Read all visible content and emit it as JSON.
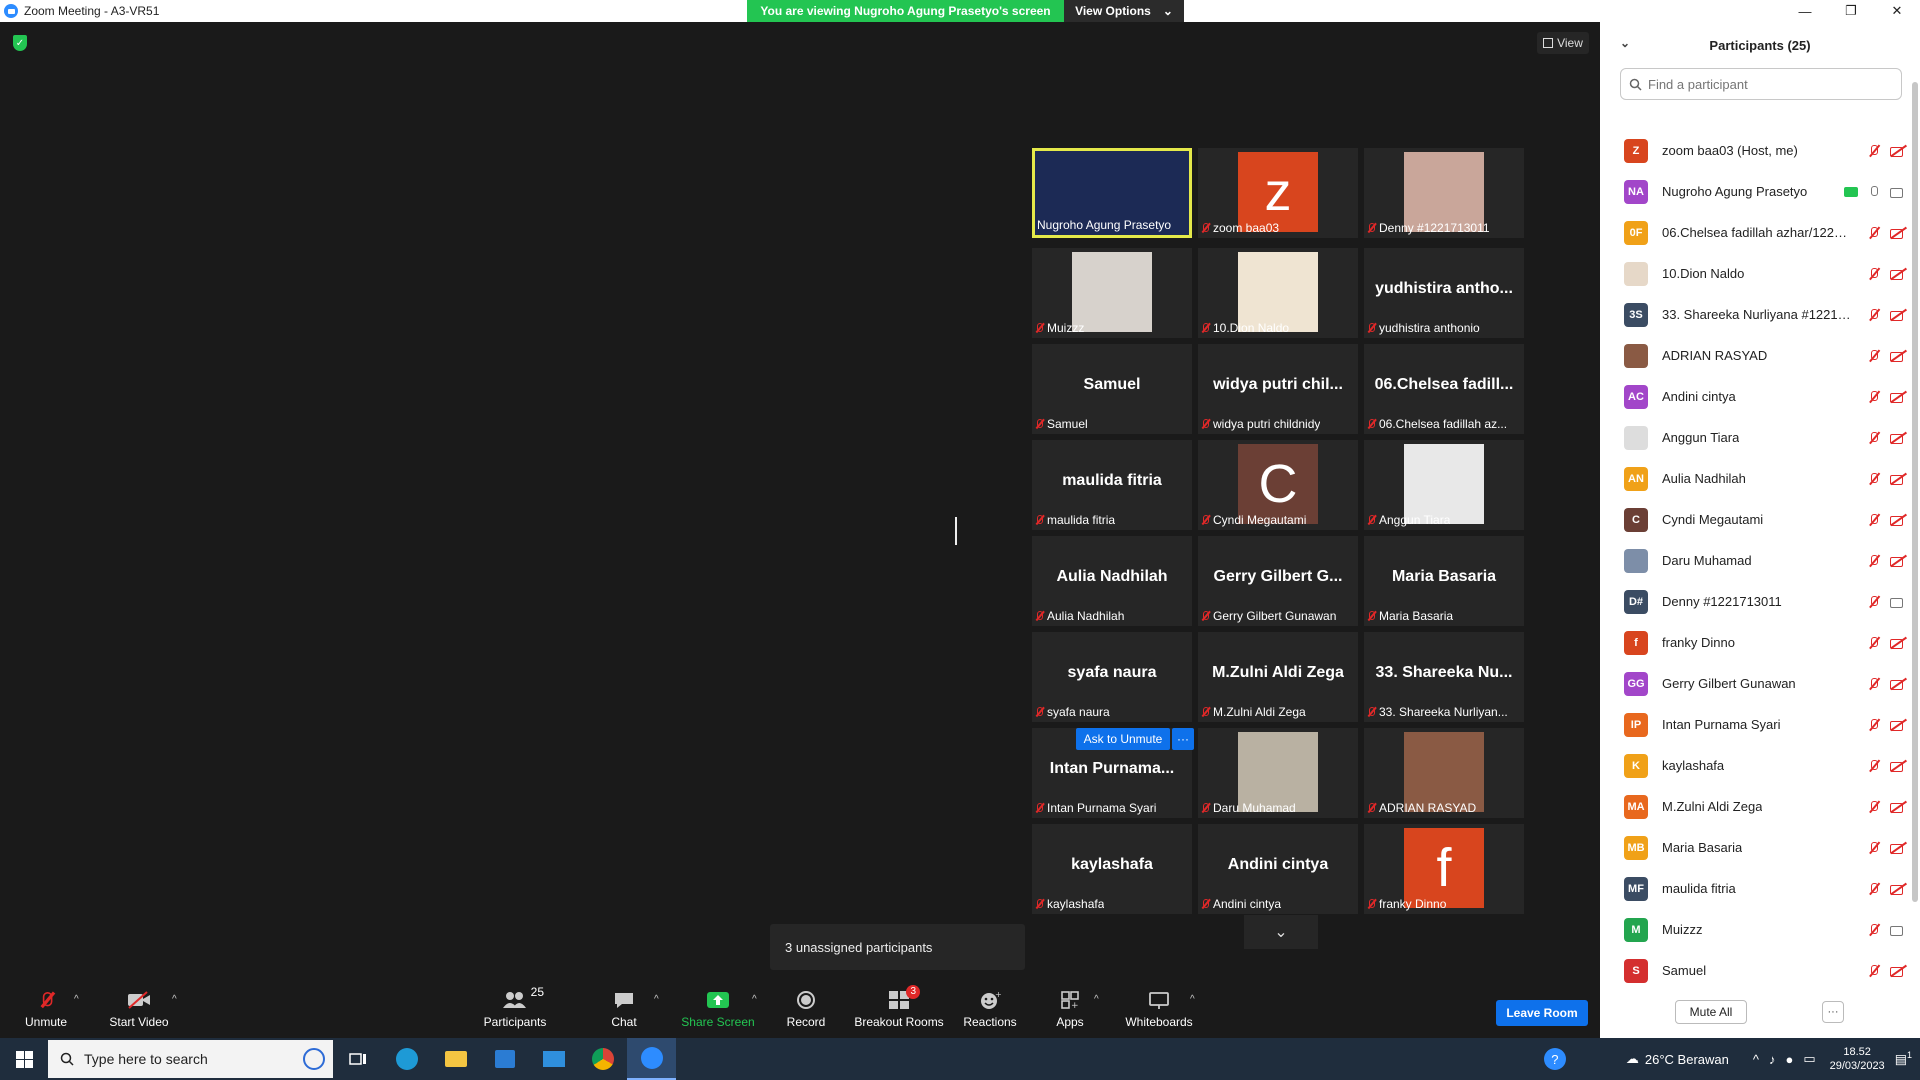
{
  "window": {
    "title": "Zoom Meeting - A3-VR51",
    "banner_text": "You are viewing Nugroho Agung Prasetyo's screen",
    "view_options_label": "View Options",
    "controls": [
      "—",
      "❐",
      "✕"
    ]
  },
  "main": {
    "view_label": "View",
    "ask_to_unmute_label": "Ask to Unmute",
    "ask_more_label": "···",
    "unassigned_text": "3 unassigned participants"
  },
  "gallery": [
    {
      "big": "",
      "tag": "Nugroho Agung Prasetyo",
      "muted": false,
      "kind": "photo",
      "color": "#1c2a55",
      "active": true
    },
    {
      "big": "",
      "tag": "zoom baa03",
      "muted": true,
      "kind": "avatar",
      "letter": "z",
      "color": "#d8451e"
    },
    {
      "big": "",
      "tag": "Denny #1221713011",
      "muted": true,
      "kind": "photo",
      "color": "#c9a69a"
    },
    {
      "big": "",
      "tag": "Muizzz",
      "muted": true,
      "kind": "photo",
      "color": "#d7d2cc"
    },
    {
      "big": "",
      "tag": "10.Dion Naldo",
      "muted": true,
      "kind": "photo",
      "color": "#efe4d2"
    },
    {
      "big": "yudhistira antho...",
      "tag": "yudhistira anthonio",
      "muted": true,
      "kind": "text"
    },
    {
      "big": "Samuel",
      "tag": "Samuel",
      "muted": true,
      "kind": "text"
    },
    {
      "big": "widya putri chil...",
      "tag": "widya putri childnidy",
      "muted": true,
      "kind": "text"
    },
    {
      "big": "06.Chelsea fadill...",
      "tag": "06.Chelsea fadillah az...",
      "muted": true,
      "kind": "text"
    },
    {
      "big": "maulida fitria",
      "tag": "maulida fitria",
      "muted": true,
      "kind": "text"
    },
    {
      "big": "",
      "tag": "Cyndi Megautami",
      "muted": true,
      "kind": "avatar",
      "letter": "C",
      "color": "#6b3f35"
    },
    {
      "big": "",
      "tag": "Anggun Tiara",
      "muted": true,
      "kind": "photo",
      "color": "#e8e8e8"
    },
    {
      "big": "Aulia Nadhilah",
      "tag": "Aulia Nadhilah",
      "muted": true,
      "kind": "text"
    },
    {
      "big": "Gerry Gilbert G...",
      "tag": "Gerry Gilbert Gunawan",
      "muted": true,
      "kind": "text"
    },
    {
      "big": "Maria Basaria",
      "tag": "Maria Basaria",
      "muted": true,
      "kind": "text"
    },
    {
      "big": "syafa naura",
      "tag": "syafa naura",
      "muted": true,
      "kind": "text"
    },
    {
      "big": "M.Zulni Aldi Zega",
      "tag": "M.Zulni Aldi Zega",
      "muted": true,
      "kind": "text"
    },
    {
      "big": "33. Shareeka Nu...",
      "tag": "33. Shareeka Nurliyan...",
      "muted": true,
      "kind": "text"
    },
    {
      "big": "Intan Purnama...",
      "tag": "Intan Purnama Syari",
      "muted": true,
      "kind": "text"
    },
    {
      "big": "",
      "tag": "Daru Muhamad",
      "muted": true,
      "kind": "photo",
      "color": "#b9b1a2"
    },
    {
      "big": "",
      "tag": "ADRIAN RASYAD",
      "muted": true,
      "kind": "photo",
      "color": "#8a5a44"
    },
    {
      "big": "kaylashafa",
      "tag": "kaylashafa",
      "muted": true,
      "kind": "text"
    },
    {
      "big": "Andini cintya",
      "tag": "Andini cintya",
      "muted": true,
      "kind": "text"
    },
    {
      "big": "",
      "tag": "franky Dinno",
      "muted": true,
      "kind": "avatar",
      "letter": "f",
      "color": "#d8451e"
    }
  ],
  "toolbar": {
    "unmute_label": "Unmute",
    "start_video_label": "Start Video",
    "participants_label": "Participants",
    "participants_count": "25",
    "chat_label": "Chat",
    "share_label": "Share Screen",
    "record_label": "Record",
    "breakout_label": "Breakout Rooms",
    "breakout_badge": "3",
    "reactions_label": "Reactions",
    "apps_label": "Apps",
    "whiteboards_label": "Whiteboards",
    "leave_label": "Leave Room"
  },
  "panel": {
    "title": "Participants (25)",
    "search_placeholder": "Find a participant",
    "mute_all_label": "Mute All",
    "more_label": "···",
    "participants": [
      {
        "initials": "Z",
        "name": "zoom baa03 (Host, me)",
        "color": "#d8451e",
        "share": false,
        "mic": "off",
        "cam": "off"
      },
      {
        "initials": "NA",
        "name": "Nugroho Agung Prasetyo",
        "color": "#a246c9",
        "share": true,
        "mic": "on",
        "cam": "on"
      },
      {
        "initials": "0F",
        "name": "06.Chelsea fadillah azhar/1221...",
        "color": "#f0a118",
        "share": false,
        "mic": "off",
        "cam": "off"
      },
      {
        "initials": "",
        "name": "10.Dion Naldo",
        "color": "#e6d8c8",
        "share": false,
        "mic": "off",
        "cam": "off"
      },
      {
        "initials": "3S",
        "name": "33. Shareeka Nurliyana #12217...",
        "color": "#3b4c63",
        "share": false,
        "mic": "off",
        "cam": "off"
      },
      {
        "initials": "",
        "name": "ADRIAN RASYAD",
        "color": "#8a5a44",
        "share": false,
        "mic": "off",
        "cam": "off"
      },
      {
        "initials": "AC",
        "name": "Andini cintya",
        "color": "#a246c9",
        "share": false,
        "mic": "off",
        "cam": "off"
      },
      {
        "initials": "",
        "name": "Anggun Tiara",
        "color": "#dddddd",
        "share": false,
        "mic": "off",
        "cam": "off"
      },
      {
        "initials": "AN",
        "name": "Aulia Nadhilah",
        "color": "#f0a118",
        "share": false,
        "mic": "off",
        "cam": "off"
      },
      {
        "initials": "C",
        "name": "Cyndi Megautami",
        "color": "#6b3f35",
        "share": false,
        "mic": "off",
        "cam": "off"
      },
      {
        "initials": "",
        "name": "Daru Muhamad",
        "color": "#7d8ea8",
        "share": false,
        "mic": "off",
        "cam": "off"
      },
      {
        "initials": "D#",
        "name": "Denny #1221713011",
        "color": "#3b4c63",
        "share": false,
        "mic": "off",
        "cam": "on"
      },
      {
        "initials": "f",
        "name": "franky Dinno",
        "color": "#d8451e",
        "share": false,
        "mic": "off",
        "cam": "off"
      },
      {
        "initials": "GG",
        "name": "Gerry Gilbert Gunawan",
        "color": "#a246c9",
        "share": false,
        "mic": "off",
        "cam": "off"
      },
      {
        "initials": "IP",
        "name": "Intan Purnama Syari",
        "color": "#e8681e",
        "share": false,
        "mic": "off",
        "cam": "off"
      },
      {
        "initials": "K",
        "name": "kaylashafa",
        "color": "#f0a118",
        "share": false,
        "mic": "off",
        "cam": "off"
      },
      {
        "initials": "MA",
        "name": "M.Zulni Aldi Zega",
        "color": "#e8681e",
        "share": false,
        "mic": "off",
        "cam": "off"
      },
      {
        "initials": "MB",
        "name": "Maria Basaria",
        "color": "#f0a118",
        "share": false,
        "mic": "off",
        "cam": "off"
      },
      {
        "initials": "MF",
        "name": "maulida fitria",
        "color": "#3b4c63",
        "share": false,
        "mic": "off",
        "cam": "off"
      },
      {
        "initials": "M",
        "name": "Muizzz",
        "color": "#23a54f",
        "share": false,
        "mic": "off",
        "cam": "on"
      },
      {
        "initials": "S",
        "name": "Samuel",
        "color": "#d42f2f",
        "share": false,
        "mic": "off",
        "cam": "off"
      }
    ]
  },
  "taskbar": {
    "search_placeholder": "Type here to search",
    "weather": "26°C  Berawan",
    "time": "18.52",
    "date": "29/03/2023",
    "notification_count": "1"
  }
}
